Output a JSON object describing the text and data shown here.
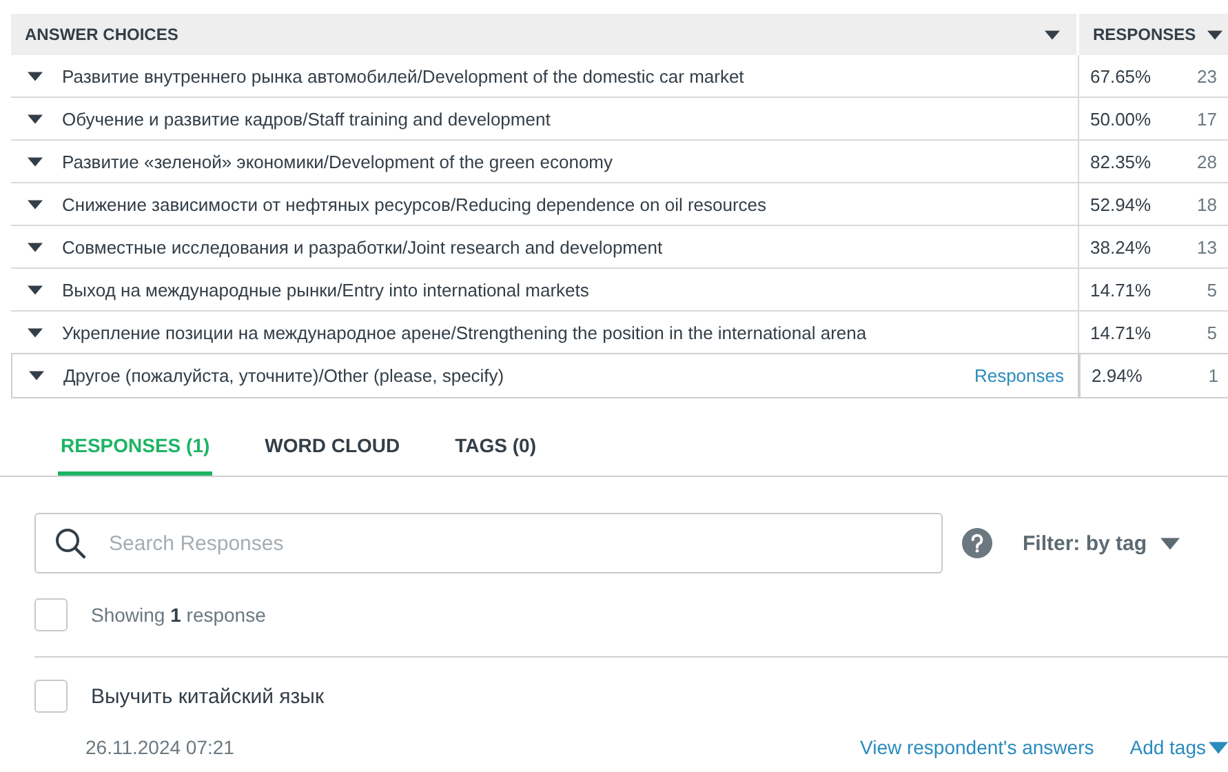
{
  "table": {
    "columns": [
      {
        "label": "ANSWER CHOICES"
      },
      {
        "label": "RESPONSES"
      }
    ],
    "rows": [
      {
        "answer": "Развитие внутреннего рынка автомобилей/Development of the domestic car market",
        "percent": "67.65%",
        "count": "23",
        "selected": false
      },
      {
        "answer": "Обучение и развитие кадров/Staff training and development",
        "percent": "50.00%",
        "count": "17",
        "selected": false
      },
      {
        "answer": "Развитие «зеленой» экономики/Development of the green economy",
        "percent": "82.35%",
        "count": "28",
        "selected": false
      },
      {
        "answer": "Снижение зависимости от нефтяных ресурсов/Reducing dependence on oil resources",
        "percent": "52.94%",
        "count": "18",
        "selected": false
      },
      {
        "answer": "Совместные исследования и разработки/Joint research and development",
        "percent": "38.24%",
        "count": "13",
        "selected": false
      },
      {
        "answer": "Выход на международные рынки/Entry into international markets",
        "percent": "14.71%",
        "count": "5",
        "selected": false
      },
      {
        "answer": "Укрепление позиции на международное арене/Strengthening the position in the international arena",
        "percent": "14.71%",
        "count": "5",
        "selected": false
      },
      {
        "answer": "Другое (пожалуйста, уточните)/Other (please, specify)",
        "link": "Responses",
        "percent": "2.94%",
        "count": "1",
        "selected": true
      }
    ]
  },
  "tabs": [
    {
      "label": "RESPONSES (1)",
      "selected": true
    },
    {
      "label": "WORD CLOUD",
      "selected": false
    },
    {
      "label": "TAGS (0)",
      "selected": false
    }
  ],
  "search": {
    "placeholder": "Search Responses"
  },
  "filter": {
    "label": "Filter: by tag"
  },
  "showing": {
    "text": "Showing **1** response",
    "checked": false
  },
  "responses": [
    {
      "text": "Выучить китайский язык",
      "checked": false,
      "date": "26.11.2024 07:21",
      "view_link": "View respondent's answers",
      "tags_link": "Add tags"
    }
  ]
}
